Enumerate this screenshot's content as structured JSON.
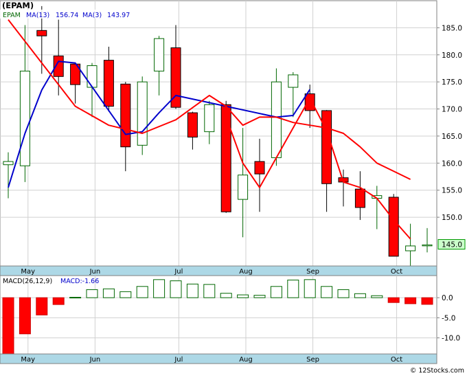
{
  "chart_data": [
    {
      "type": "candlestick",
      "ticker_label": "(EPAM)",
      "legend": [
        {
          "label": "EPAM",
          "color": "#006600"
        },
        {
          "label": "MA(13)",
          "value": "156.74",
          "color": "#0000cc"
        },
        {
          "label": "MA(3)",
          "value": "143.97",
          "color": "#0000cc"
        }
      ],
      "ylim": [
        141,
        190
      ],
      "y_ticks": [
        150,
        155,
        160,
        165,
        170,
        175,
        180,
        185
      ],
      "y_tick_labels": [
        "150.0",
        "155.0",
        "160.0",
        "165.0",
        "170.0",
        "175.0",
        "180.0",
        "185.0"
      ],
      "month_labels": [
        "May",
        "Jun",
        "Jul",
        "Aug",
        "Sep",
        "Oct"
      ],
      "month_positions": [
        1.2,
        5.2,
        10.2,
        14.2,
        18.2,
        23.2
      ],
      "last_price_label": "145.0",
      "last_price": 145.0,
      "up_color": "#006600",
      "down_color": "#ff0000",
      "candles": [
        {
          "o": 159.7,
          "h": 162.0,
          "l": 153.5,
          "c": 160.3
        },
        {
          "o": 159.5,
          "h": 185.5,
          "l": 156.5,
          "c": 177.0
        },
        {
          "o": 184.5,
          "h": 189.0,
          "l": 176.5,
          "c": 183.5
        },
        {
          "o": 179.8,
          "h": 186.5,
          "l": 172.5,
          "c": 176.0
        },
        {
          "o": 178.3,
          "h": 178.5,
          "l": 171.0,
          "c": 174.5
        },
        {
          "o": 174.0,
          "h": 178.5,
          "l": 168.5,
          "c": 178.0
        },
        {
          "o": 179.0,
          "h": 181.5,
          "l": 169.5,
          "c": 170.5
        },
        {
          "o": 174.6,
          "h": 175.0,
          "l": 158.5,
          "c": 163.0
        },
        {
          "o": 163.3,
          "h": 176.0,
          "l": 161.5,
          "c": 175.0
        },
        {
          "o": 177.0,
          "h": 183.5,
          "l": 172.5,
          "c": 183.0
        },
        {
          "o": 181.3,
          "h": 185.5,
          "l": 170.0,
          "c": 170.3
        },
        {
          "o": 169.3,
          "h": 169.5,
          "l": 162.5,
          "c": 164.8
        },
        {
          "o": 165.8,
          "h": 171.5,
          "l": 163.5,
          "c": 170.8
        },
        {
          "o": 170.8,
          "h": 171.5,
          "l": 150.8,
          "c": 151.0
        },
        {
          "o": 153.3,
          "h": 166.5,
          "l": 146.3,
          "c": 157.8
        },
        {
          "o": 160.3,
          "h": 164.5,
          "l": 151.0,
          "c": 158.0
        },
        {
          "o": 161.0,
          "h": 177.5,
          "l": 159.5,
          "c": 175.0
        },
        {
          "o": 174.0,
          "h": 176.8,
          "l": 168.5,
          "c": 176.3
        },
        {
          "o": 172.8,
          "h": 174.5,
          "l": 166.5,
          "c": 169.7
        },
        {
          "o": 169.7,
          "h": 169.8,
          "l": 151.0,
          "c": 156.2
        },
        {
          "o": 157.3,
          "h": 158.8,
          "l": 152.0,
          "c": 156.5
        },
        {
          "o": 155.2,
          "h": 158.5,
          "l": 149.5,
          "c": 151.8
        },
        {
          "o": 153.5,
          "h": 155.8,
          "l": 147.8,
          "c": 154.0
        },
        {
          "o": 153.7,
          "h": 154.3,
          "l": 143.0,
          "c": 142.8
        },
        {
          "o": 143.8,
          "h": 148.8,
          "l": 141.0,
          "c": 144.7
        },
        {
          "o": 144.9,
          "h": 148.0,
          "l": 143.5,
          "c": 144.9
        }
      ],
      "series": [
        {
          "name": "MA(3)",
          "color": "#0000cc",
          "x": [
            0,
            1,
            2,
            3,
            4,
            7,
            8,
            9,
            10,
            16,
            17,
            18
          ],
          "values": [
            155.5,
            165.5,
            173.5,
            178.8,
            178.5,
            165.3,
            165.8,
            169.3,
            172.5,
            168.5,
            168.8,
            173.6
          ]
        },
        {
          "name": "MA(13)",
          "color": "#ff0000",
          "x": [
            0,
            2,
            4,
            6,
            8,
            10,
            12,
            13,
            14,
            15,
            16,
            17,
            18,
            19,
            20,
            21,
            22,
            23,
            24
          ],
          "values": [
            186.5,
            178.5,
            170.5,
            167.0,
            165.5,
            168.0,
            172.5,
            170.5,
            167.0,
            168.5,
            168.5,
            167.5,
            167.0,
            166.5,
            165.5,
            163.0,
            160.0,
            158.5,
            157.0
          ]
        },
        {
          "name": "MA(3)",
          "color": "#ff0000",
          "x": [
            13,
            14,
            15,
            18,
            19,
            20,
            21,
            22,
            23,
            24
          ],
          "values": [
            168.5,
            160.0,
            155.5,
            172.0,
            166.0,
            156.5,
            155.5,
            153.5,
            149.5,
            146.0
          ]
        }
      ]
    },
    {
      "type": "bar",
      "title": "MACD(26,12,9)",
      "value_label": "MACD:-1.66",
      "ylim": [
        -14,
        5.5
      ],
      "y_ticks": [
        0,
        -5,
        -10
      ],
      "y_tick_labels": [
        "0.0",
        "-5.0",
        "-10.0"
      ],
      "month_labels": [
        "May",
        "Jun",
        "Jul",
        "Aug",
        "Sep",
        "Oct"
      ],
      "values": [
        -14.0,
        -9.0,
        -4.3,
        -1.7,
        0.1,
        2.0,
        2.2,
        1.5,
        2.8,
        4.5,
        4.2,
        3.4,
        3.3,
        1.1,
        0.7,
        0.6,
        2.8,
        4.4,
        4.5,
        2.8,
        2.0,
        1.0,
        0.5,
        -1.2,
        -1.5,
        -1.66
      ]
    }
  ],
  "footer": {
    "copyright": "© 12Stocks.com"
  }
}
